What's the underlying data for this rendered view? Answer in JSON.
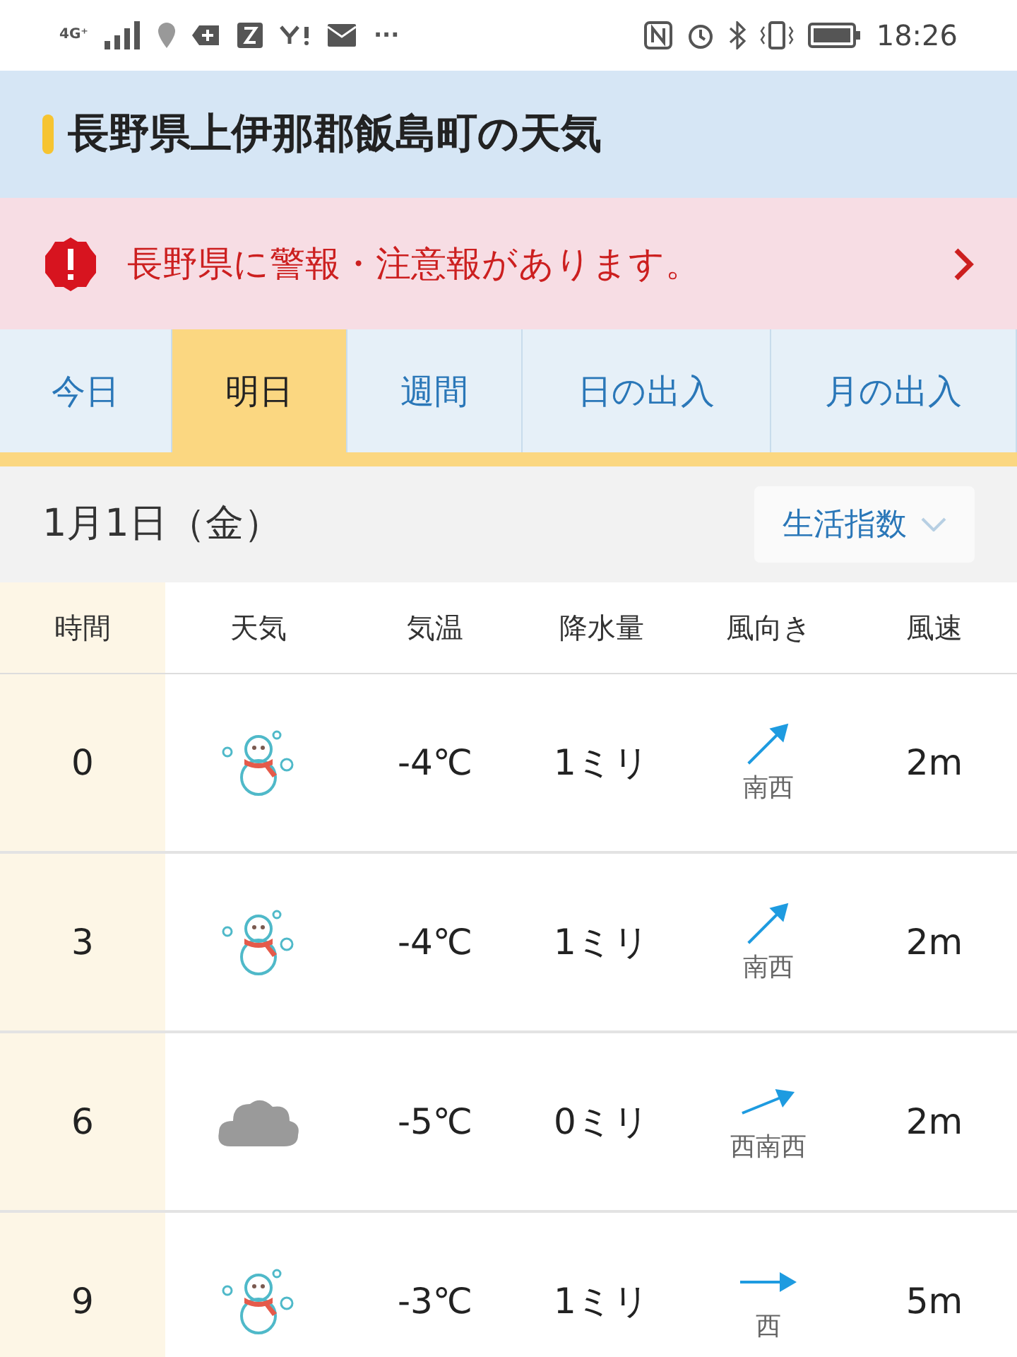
{
  "status_bar": {
    "network": "4G⁺",
    "time": "18:26",
    "more": "···"
  },
  "header": {
    "title": "長野県上伊那郡飯島町の天気"
  },
  "alert": {
    "text": "長野県に警報・注意報があります。"
  },
  "tabs": [
    {
      "label": "今日",
      "selected": false
    },
    {
      "label": "明日",
      "selected": true
    },
    {
      "label": "週間",
      "selected": false
    },
    {
      "label": "日の出入",
      "selected": false
    },
    {
      "label": "月の出入",
      "selected": false
    }
  ],
  "date_bar": {
    "date": "1月1日（金）",
    "index_button": "生活指数"
  },
  "table": {
    "columns": [
      "時間",
      "天気",
      "気温",
      "降水量",
      "風向き",
      "風速"
    ],
    "rows": [
      {
        "hour": "0",
        "weather": {
          "kind": "snow"
        },
        "temp": "-4℃",
        "precip": "1ミリ",
        "wind": {
          "direction": "南西",
          "kind": "sw"
        },
        "wind_speed": "2m"
      },
      {
        "hour": "3",
        "weather": {
          "kind": "snow"
        },
        "temp": "-4℃",
        "precip": "1ミリ",
        "wind": {
          "direction": "南西",
          "kind": "sw"
        },
        "wind_speed": "2m"
      },
      {
        "hour": "6",
        "weather": {
          "kind": "cloudy"
        },
        "temp": "-5℃",
        "precip": "0ミリ",
        "wind": {
          "direction": "西南西",
          "kind": "wsw"
        },
        "wind_speed": "2m"
      },
      {
        "hour": "9",
        "weather": {
          "kind": "snow"
        },
        "temp": "-3℃",
        "precip": "1ミリ",
        "wind": {
          "direction": "西",
          "kind": "w"
        },
        "wind_speed": "5m"
      }
    ]
  }
}
